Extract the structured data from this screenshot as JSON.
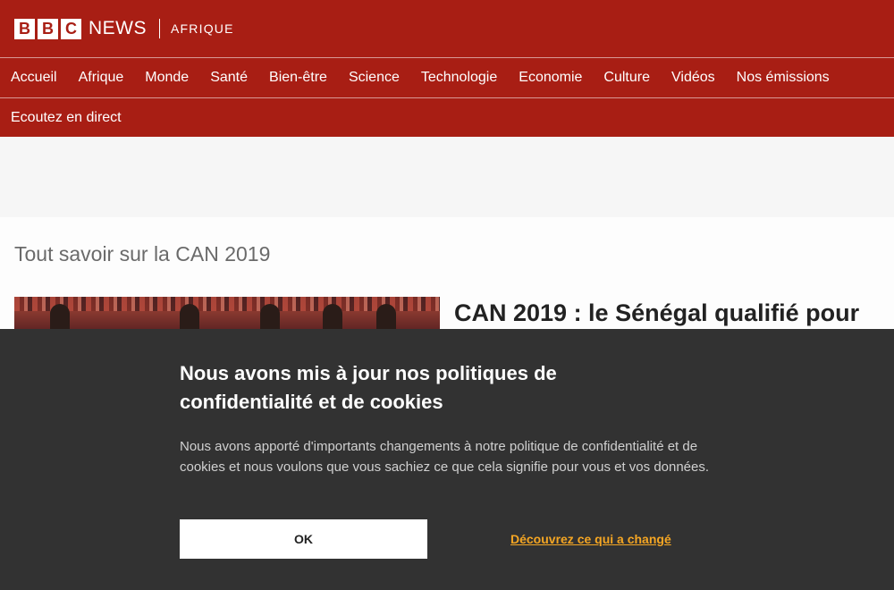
{
  "brand": {
    "letters": [
      "B",
      "B",
      "C"
    ],
    "news": "NEWS",
    "edition": "AFRIQUE"
  },
  "nav": {
    "row1": [
      "Accueil",
      "Afrique",
      "Monde",
      "Santé",
      "Bien-être",
      "Science",
      "Technologie",
      "Economie",
      "Culture",
      "Vidéos",
      "Nos émissions"
    ],
    "row2": [
      "Ecoutez en direct"
    ]
  },
  "section": {
    "title": "Tout savoir sur la CAN 2019"
  },
  "story": {
    "headline": "CAN 2019 : le Sénégal qualifié pour"
  },
  "cookie": {
    "title": "Nous avons mis à jour nos politiques de confidentialité et de cookies",
    "text": "Nous avons apporté d'importants changements à notre politique de confidentialité et de cookies et nous voulons que vous sachiez ce que cela signifie pour vous et vos données.",
    "ok_label": "OK",
    "link_label": "Découvrez ce qui a changé"
  },
  "colors": {
    "header_bg": "#a81e14",
    "banner_bg": "#323232",
    "link_accent": "#f5a623"
  }
}
